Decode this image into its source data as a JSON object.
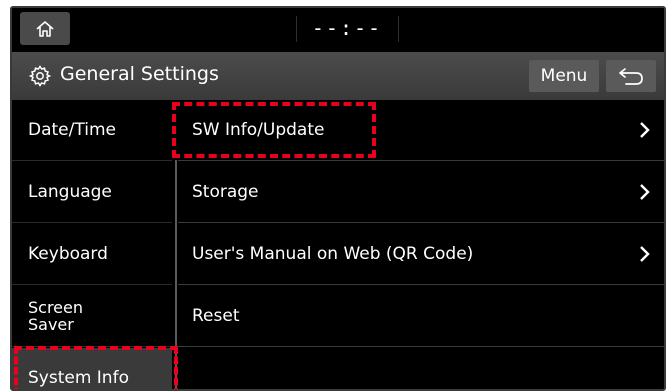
{
  "statusbar": {
    "clock": "--:--"
  },
  "titlebar": {
    "icon": "gear-icon",
    "title": "General Settings",
    "menu_label": "Menu",
    "back_icon": "back-arrow-icon"
  },
  "leftnav": {
    "items": [
      {
        "label": "Date/Time"
      },
      {
        "label": "Language"
      },
      {
        "label": "Keyboard"
      },
      {
        "label": "Screen\nSaver"
      },
      {
        "label": "System Info",
        "selected": true
      }
    ]
  },
  "content": {
    "rows": [
      {
        "label": "SW Info/Update",
        "chevron": true
      },
      {
        "label": "Storage",
        "chevron": true
      },
      {
        "label": "User's Manual on Web (QR Code)",
        "chevron": true
      },
      {
        "label": "Reset",
        "chevron": false
      }
    ]
  },
  "colors": {
    "highlight": "#e8001c",
    "background": "#000000",
    "titlebar": "#444444"
  }
}
